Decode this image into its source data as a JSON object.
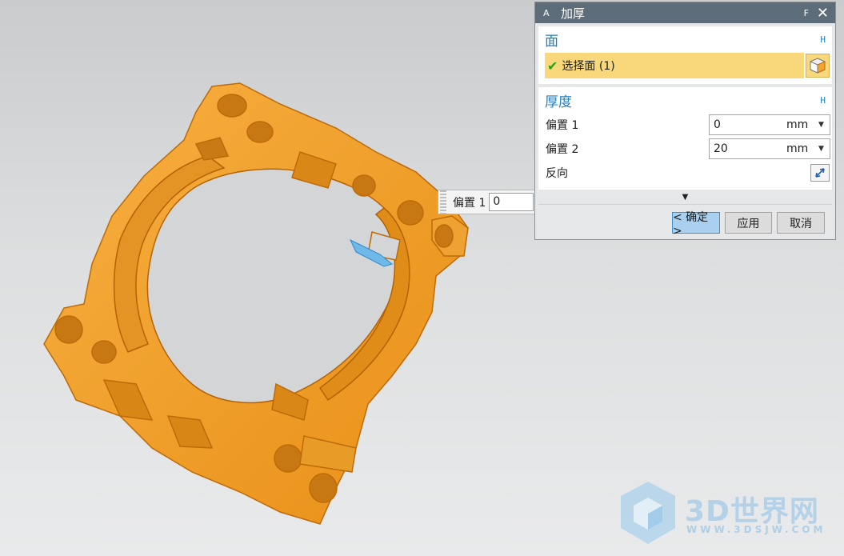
{
  "dialog": {
    "title_prefix": "A",
    "title": "加厚",
    "title_suffix": "F",
    "close_glyph": "✕",
    "face_group": {
      "title": "面",
      "collapse": "H",
      "select_check": "✔",
      "select_label": "选择面 (1)"
    },
    "thickness_group": {
      "title": "厚度",
      "collapse": "H",
      "offset1": {
        "label": "偏置 1",
        "value": "0",
        "unit": "mm"
      },
      "offset2": {
        "label": "偏置 2",
        "value": "20",
        "unit": "mm"
      },
      "reverse_label": "反向"
    },
    "expander_glyph": "▼",
    "buttons": {
      "ok": "< 确定 >",
      "apply": "应用",
      "cancel": "取消"
    }
  },
  "float_input": {
    "label": "偏置 1",
    "value": "0"
  },
  "watermark": {
    "text": "3D世界网",
    "url": "WWW.3DSJW.COM"
  },
  "colors": {
    "part_orange": "#f5a12a",
    "part_edge": "#c56d08",
    "dialog_title_bg": "#5d6c79",
    "selection_bg": "#f8d87a",
    "group_title": "#1f7fb8",
    "ok_button": "#a9d1ef"
  }
}
